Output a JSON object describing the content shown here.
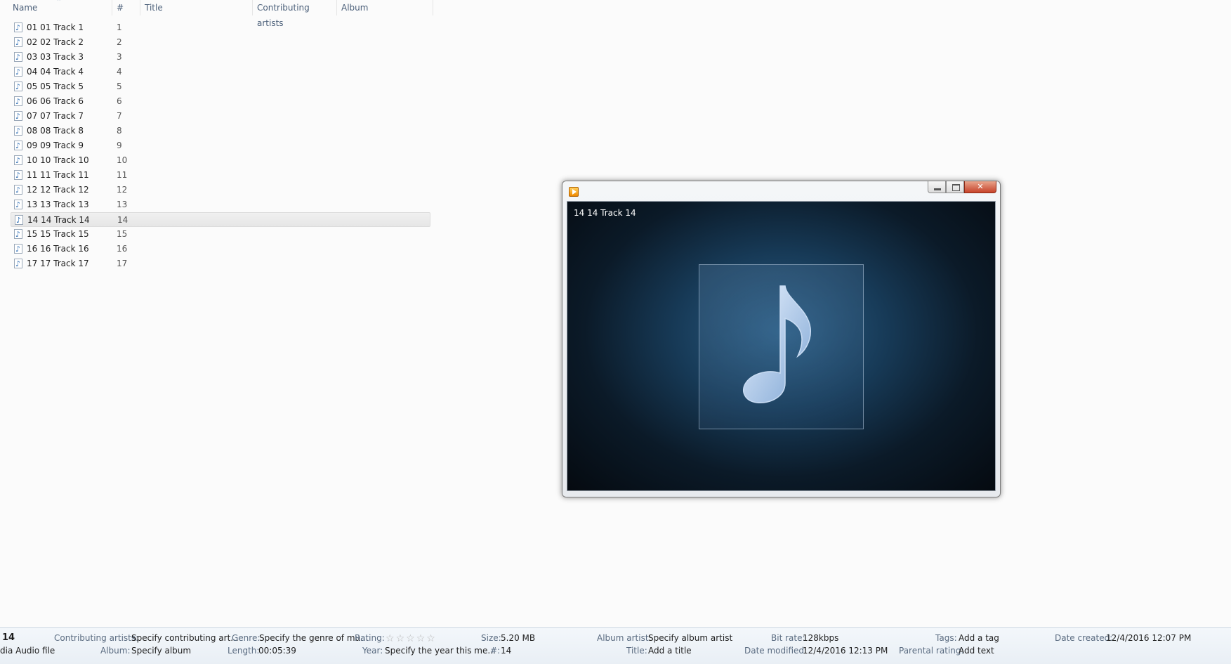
{
  "columns": {
    "name": "Name",
    "number": "#",
    "title": "Title",
    "contributing_artists": "Contributing artists",
    "album": "Album"
  },
  "files": [
    {
      "name": "01 01 Track 1",
      "num": "1"
    },
    {
      "name": "02 02 Track 2",
      "num": "2"
    },
    {
      "name": "03 03 Track 3",
      "num": "3"
    },
    {
      "name": "04 04 Track 4",
      "num": "4"
    },
    {
      "name": "05 05 Track 5",
      "num": "5"
    },
    {
      "name": "06 06 Track 6",
      "num": "6"
    },
    {
      "name": "07 07 Track 7",
      "num": "7"
    },
    {
      "name": "08 08 Track 8",
      "num": "8"
    },
    {
      "name": "09 09 Track 9",
      "num": "9"
    },
    {
      "name": "10 10 Track 10",
      "num": "10"
    },
    {
      "name": "11 11 Track 11",
      "num": "11"
    },
    {
      "name": "12 12 Track 12",
      "num": "12"
    },
    {
      "name": "13 13 Track 13",
      "num": "13"
    },
    {
      "name": "14 14 Track 14",
      "num": "14"
    },
    {
      "name": "15 15 Track 15",
      "num": "15"
    },
    {
      "name": "16 16 Track 16",
      "num": "16"
    },
    {
      "name": "17 17 Track 17",
      "num": "17"
    }
  ],
  "selected_index": 13,
  "player": {
    "now_playing": "14 14 Track 14",
    "app_icon": "media-player-icon",
    "buttons": {
      "minimize": "minimize-icon",
      "maximize": "maximize-icon",
      "close": "close-icon"
    }
  },
  "details": {
    "track_no": "14",
    "file_type": "dia Audio file",
    "contributing_artists_label": "Contributing artists:",
    "contributing_artists_value": "Specify contributing art...",
    "album_label": "Album:",
    "album_value": "Specify album",
    "genre_label": "Genre:",
    "genre_value": "Specify the genre of mu...",
    "length_label": "Length:",
    "length_value": "00:05:39",
    "rating_label": "Rating:",
    "rating_stars": 0,
    "year_label": "Year:",
    "year_value": "Specify the year this me...",
    "size_label": "Size:",
    "size_value": "5.20 MB",
    "number_label": "#:",
    "number_value": "14",
    "album_artist_label": "Album artist:",
    "album_artist_value": "Specify album artist",
    "title_label": "Title:",
    "title_value": "Add a title",
    "bitrate_label": "Bit rate:",
    "bitrate_value": "128kbps",
    "date_modified_label": "Date modified:",
    "date_modified_value": "12/4/2016 12:13 PM",
    "tags_label": "Tags:",
    "tags_value": "Add a tag",
    "parental_label": "Parental rating:",
    "parental_value": "Add text",
    "date_created_label": "Date created:",
    "date_created_value": "12/4/2016 12:07 PM"
  }
}
